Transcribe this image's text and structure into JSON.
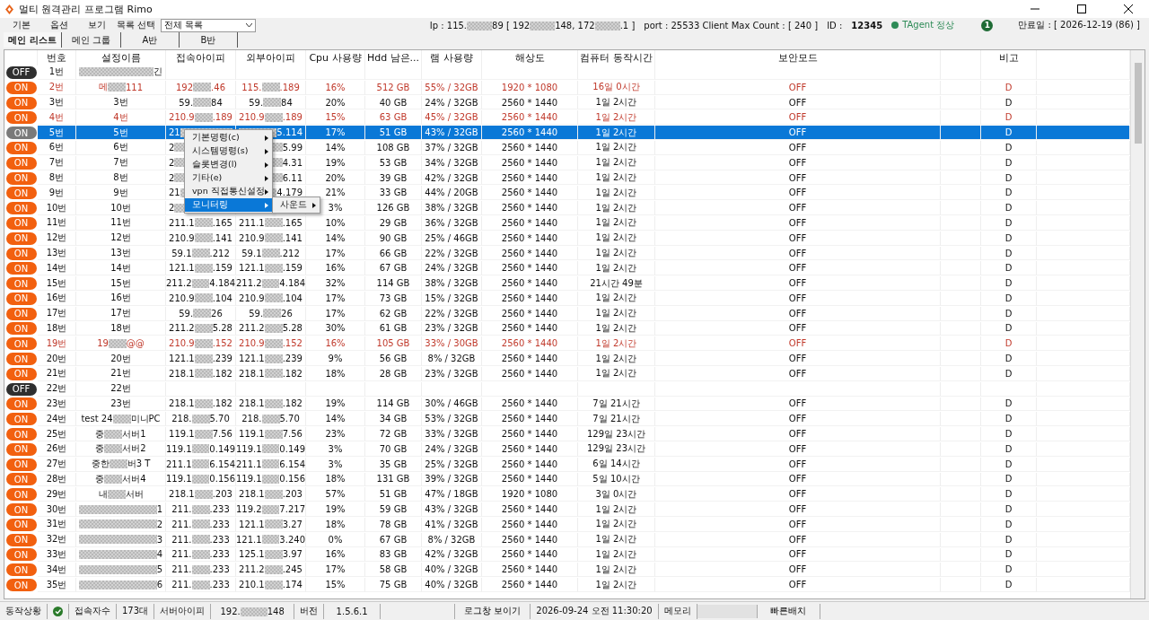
{
  "window": {
    "title": "멀티 원격관리 프로그램 Rimo"
  },
  "menu": [
    "기본",
    "옵션",
    "보기"
  ],
  "list_select": {
    "label": "목록 선택",
    "value": "전체 목록"
  },
  "info": {
    "ip_parts": [
      "Ip : 115.",
      "89 [ 192",
      "148, 172",
      ".1 ]"
    ],
    "port": "port : 25533 Client Max Count :  [ 240 ]",
    "id_label": "ID :",
    "id": "12345",
    "agent": "TAgent 정상",
    "badge": "1",
    "expiry": "만료일 : [ 2026-12-19 (86) ]"
  },
  "tabs": [
    {
      "label": "메인 리스트",
      "selected": true
    },
    {
      "label": "메인 그룹",
      "selected": false
    },
    {
      "label": "A반",
      "selected": false
    },
    {
      "label": "B반",
      "selected": false
    }
  ],
  "table": {
    "columns": [
      "번호",
      "설정이름",
      "접속아이피",
      "외부아이피",
      "Cpu 사용량",
      "Hdd 남은...",
      "램 사용량",
      "해상도",
      "컴퓨터 동작시간",
      "보안모드",
      "",
      "비고"
    ],
    "rows": [
      {
        "power": "OFF",
        "on": false,
        "alert": false,
        "selected": false,
        "num": "1번",
        "name": {
          "tail": "긴"
        }
      },
      {
        "power": "ON",
        "on": true,
        "alert": true,
        "selected": false,
        "num": "2번",
        "name": {
          "head": "메",
          "tail": "111"
        },
        "ip": {
          "head": "192",
          "tail": ".46"
        },
        "ext_ip": {
          "head": "115.",
          "tail": ".189"
        },
        "cpu": "16%",
        "hdd": "512 GB",
        "ram": "55% / 32GB",
        "resolution": "1920 * 1080",
        "uptime": "16일 0시간",
        "security": "OFF",
        "column_12": "D"
      },
      {
        "power": "ON",
        "on": true,
        "alert": false,
        "selected": false,
        "num": "3번",
        "name": "3번",
        "ip": {
          "head": "59.",
          "tail": "84"
        },
        "ext_ip": {
          "head": "59.",
          "tail": "84"
        },
        "cpu": "20%",
        "hdd": "40 GB",
        "ram": "24% / 32GB",
        "resolution": "2560 * 1440",
        "uptime": "1일 2시간",
        "security": "OFF",
        "column_12": "D"
      },
      {
        "power": "ON",
        "on": true,
        "alert": true,
        "selected": false,
        "num": "4번",
        "name": "4번",
        "ip": {
          "head": "210.9",
          "tail": ".189"
        },
        "ext_ip": {
          "head": "210.9",
          "tail": ".189"
        },
        "cpu": "15%",
        "hdd": "63 GB",
        "ram": "45% / 32GB",
        "resolution": "2560 * 1440",
        "uptime": "1일 2시간",
        "security": "OFF",
        "column_12": "D"
      },
      {
        "power": "ON",
        "on": true,
        "alert": false,
        "selected": true,
        "num": "5번",
        "name": "5번",
        "ip": {
          "head": "21"
        },
        "ext_ip": {
          "tail": "5.114"
        },
        "cpu": "17%",
        "hdd": "51 GB",
        "ram": "43% / 32GB",
        "resolution": "2560 * 1440",
        "uptime": "1일 2시간",
        "security": "OFF",
        "column_12": "D"
      },
      {
        "power": "ON",
        "on": true,
        "alert": false,
        "selected": false,
        "num": "6번",
        "name": "6번",
        "ip": {
          "head": "2"
        },
        "ext_ip": {
          "tail": "5.99"
        },
        "cpu": "14%",
        "hdd": "108 GB",
        "ram": "37% / 32GB",
        "resolution": "2560 * 1440",
        "uptime": "1일 2시간",
        "security": "OFF",
        "column_12": "D"
      },
      {
        "power": "ON",
        "on": true,
        "alert": false,
        "selected": false,
        "num": "7번",
        "name": "7번",
        "ip": {
          "head": "2"
        },
        "ext_ip": {
          "tail": "4.31"
        },
        "cpu": "19%",
        "hdd": "53 GB",
        "ram": "34% / 32GB",
        "resolution": "2560 * 1440",
        "uptime": "1일 2시간",
        "security": "OFF",
        "column_12": "D"
      },
      {
        "power": "ON",
        "on": true,
        "alert": false,
        "selected": false,
        "num": "8번",
        "name": "8번",
        "ip": {
          "head": "2"
        },
        "ext_ip": {
          "tail": "6.11"
        },
        "cpu": "20%",
        "hdd": "39 GB",
        "ram": "42% / 32GB",
        "resolution": "2560 * 1440",
        "uptime": "1일 2시간",
        "security": "OFF",
        "column_12": "D"
      },
      {
        "power": "ON",
        "on": true,
        "alert": false,
        "selected": false,
        "num": "9번",
        "name": "9번",
        "ip": {
          "head": "21"
        },
        "ext_ip": {
          "tail": "4.179"
        },
        "cpu": "21%",
        "hdd": "33 GB",
        "ram": "44% / 20GB",
        "resolution": "2560 * 1440",
        "uptime": "1일 2시간",
        "security": "OFF",
        "column_12": "D"
      },
      {
        "power": "ON",
        "on": true,
        "alert": false,
        "selected": false,
        "num": "10번",
        "name": "10번",
        "ip": {
          "head": "2"
        },
        "cpu": "3%",
        "hdd": "126 GB",
        "ram": "38% / 32GB",
        "resolution": "2560 * 1440",
        "uptime": "1일 2시간",
        "security": "OFF",
        "column_12": "D"
      },
      {
        "power": "ON",
        "on": true,
        "alert": false,
        "selected": false,
        "num": "11번",
        "name": "11번",
        "ip": {
          "head": "211.1",
          "tail": ".165"
        },
        "ext_ip": {
          "head": "211.1",
          "tail": ".165"
        },
        "cpu": "10%",
        "hdd": "29 GB",
        "ram": "36% / 32GB",
        "resolution": "2560 * 1440",
        "uptime": "1일 2시간",
        "security": "OFF",
        "column_12": "D"
      },
      {
        "power": "ON",
        "on": true,
        "alert": false,
        "selected": false,
        "num": "12번",
        "name": "12번",
        "ip": {
          "head": "210.9",
          "tail": ".141"
        },
        "ext_ip": {
          "head": "210.9",
          "tail": ".141"
        },
        "cpu": "14%",
        "hdd": "90 GB",
        "ram": "25% / 46GB",
        "resolution": "2560 * 1440",
        "uptime": "1일 2시간",
        "security": "OFF",
        "column_12": "D"
      },
      {
        "power": "ON",
        "on": true,
        "alert": false,
        "selected": false,
        "num": "13번",
        "name": "13번",
        "ip": {
          "head": "59.1",
          "tail": ".212"
        },
        "ext_ip": {
          "head": "59.1",
          "tail": ".212"
        },
        "cpu": "17%",
        "hdd": "66 GB",
        "ram": "22% / 32GB",
        "resolution": "2560 * 1440",
        "uptime": "1일 2시간",
        "security": "OFF",
        "column_12": "D"
      },
      {
        "power": "ON",
        "on": true,
        "alert": false,
        "selected": false,
        "num": "14번",
        "name": "14번",
        "ip": {
          "head": "121.1",
          "tail": ".159"
        },
        "ext_ip": {
          "head": "121.1",
          "tail": ".159"
        },
        "cpu": "16%",
        "hdd": "67 GB",
        "ram": "24% / 32GB",
        "resolution": "2560 * 1440",
        "uptime": "1일 2시간",
        "security": "OFF",
        "column_12": "D"
      },
      {
        "power": "ON",
        "on": true,
        "alert": false,
        "selected": false,
        "num": "15번",
        "name": "15번",
        "ip": {
          "head": "211.2",
          "tail": "4.184"
        },
        "ext_ip": {
          "head": "211.2",
          "tail": "4.184"
        },
        "cpu": "32%",
        "hdd": "114 GB",
        "ram": "38% / 32GB",
        "resolution": "2560 * 1440",
        "uptime": "21시간 49분",
        "security": "OFF",
        "column_12": "D"
      },
      {
        "power": "ON",
        "on": true,
        "alert": false,
        "selected": false,
        "num": "16번",
        "name": "16번",
        "ip": {
          "head": "210.9",
          "tail": ".104"
        },
        "ext_ip": {
          "head": "210.9",
          "tail": ".104"
        },
        "cpu": "17%",
        "hdd": "73 GB",
        "ram": "15% / 32GB",
        "resolution": "2560 * 1440",
        "uptime": "1일 2시간",
        "security": "OFF",
        "column_12": "D"
      },
      {
        "power": "ON",
        "on": true,
        "alert": false,
        "selected": false,
        "num": "17번",
        "name": "17번",
        "ip": {
          "head": "59.",
          "tail": "26"
        },
        "ext_ip": {
          "head": "59.",
          "tail": "26"
        },
        "cpu": "17%",
        "hdd": "62 GB",
        "ram": "22% / 32GB",
        "resolution": "2560 * 1440",
        "uptime": "1일 2시간",
        "security": "OFF",
        "column_12": "D"
      },
      {
        "power": "ON",
        "on": true,
        "alert": false,
        "selected": false,
        "num": "18번",
        "name": "18번",
        "ip": {
          "head": "211.2",
          "tail": "5.28"
        },
        "ext_ip": {
          "head": "211.2",
          "tail": "5.28"
        },
        "cpu": "30%",
        "hdd": "61 GB",
        "ram": "23% / 32GB",
        "resolution": "2560 * 1440",
        "uptime": "1일 2시간",
        "security": "OFF",
        "column_12": "D"
      },
      {
        "power": "ON",
        "on": true,
        "alert": true,
        "selected": false,
        "num": "19번",
        "name": {
          "head": "19",
          "tail": "@@"
        },
        "ip": {
          "head": "210.9",
          "tail": ".152"
        },
        "ext_ip": {
          "head": "210.9",
          "tail": ".152"
        },
        "cpu": "16%",
        "hdd": "105 GB",
        "ram": "33% / 30GB",
        "resolution": "2560 * 1440",
        "uptime": "1일 2시간",
        "security": "OFF",
        "column_12": "D"
      },
      {
        "power": "ON",
        "on": true,
        "alert": false,
        "selected": false,
        "num": "20번",
        "name": "20번",
        "ip": {
          "head": "121.1",
          "tail": ".239"
        },
        "ext_ip": {
          "head": "121.1",
          "tail": ".239"
        },
        "cpu": "9%",
        "hdd": "56 GB",
        "ram": "8% / 32GB",
        "resolution": "2560 * 1440",
        "uptime": "1일 2시간",
        "security": "OFF",
        "column_12": "D"
      },
      {
        "power": "ON",
        "on": true,
        "alert": false,
        "selected": false,
        "num": "21번",
        "name": "21번",
        "ip": {
          "head": "218.1",
          "tail": ".182"
        },
        "ext_ip": {
          "head": "218.1",
          "tail": ".182"
        },
        "cpu": "18%",
        "hdd": "28 GB",
        "ram": "23% / 32GB",
        "resolution": "2560 * 1440",
        "uptime": "1일 2시간",
        "security": "OFF",
        "column_12": "D"
      },
      {
        "power": "OFF",
        "on": false,
        "alert": false,
        "selected": false,
        "num": "22번",
        "name": "22번"
      },
      {
        "power": "ON",
        "on": true,
        "alert": false,
        "selected": false,
        "num": "23번",
        "name": "23번",
        "ip": {
          "head": "218.1",
          "tail": ".182"
        },
        "ext_ip": {
          "head": "218.1",
          "tail": ".182"
        },
        "cpu": "19%",
        "hdd": "114 GB",
        "ram": "30% / 46GB",
        "resolution": "2560 * 1440",
        "uptime": "7일 21시간",
        "security": "OFF",
        "column_12": "D"
      },
      {
        "power": "ON",
        "on": true,
        "alert": false,
        "selected": false,
        "num": "24번",
        "name": {
          "head": "test 24",
          "tail": " 미니PC"
        },
        "ip": {
          "head": "218.",
          "tail": "5.70"
        },
        "ext_ip": {
          "head": "218.",
          "tail": "5.70"
        },
        "cpu": "14%",
        "hdd": "34 GB",
        "ram": "53% / 32GB",
        "resolution": "2560 * 1440",
        "uptime": "7일 21시간",
        "security": "OFF",
        "column_12": "D"
      },
      {
        "power": "ON",
        "on": true,
        "alert": false,
        "selected": false,
        "num": "25번",
        "name": {
          "head": "중",
          "tail": "서버1"
        },
        "ip": {
          "head": "119.1",
          "tail": "7.56"
        },
        "ext_ip": {
          "head": "119.1",
          "tail": "7.56"
        },
        "cpu": "23%",
        "hdd": "72 GB",
        "ram": "33% / 32GB",
        "resolution": "2560 * 1440",
        "uptime": "129일 23시간",
        "security": "OFF",
        "column_12": "D"
      },
      {
        "power": "ON",
        "on": true,
        "alert": false,
        "selected": false,
        "num": "26번",
        "name": {
          "head": "중",
          "tail": "서버2"
        },
        "ip": {
          "head": "119.1",
          "tail": "0.149"
        },
        "ext_ip": {
          "head": "119.1",
          "tail": "0.149"
        },
        "cpu": "3%",
        "hdd": "70 GB",
        "ram": "24% / 32GB",
        "resolution": "2560 * 1440",
        "uptime": "129일 23시간",
        "security": "OFF",
        "column_12": "D"
      },
      {
        "power": "ON",
        "on": true,
        "alert": false,
        "selected": false,
        "num": "27번",
        "name": {
          "head": "중한",
          "tail": "버3 T"
        },
        "ip": {
          "head": "211.1",
          "tail": "6.154"
        },
        "ext_ip": {
          "head": "211.1",
          "tail": "6.154"
        },
        "cpu": "3%",
        "hdd": "35 GB",
        "ram": "25% / 32GB",
        "resolution": "2560 * 1440",
        "uptime": "6일 14시간",
        "security": "OFF",
        "column_12": "D"
      },
      {
        "power": "ON",
        "on": true,
        "alert": false,
        "selected": false,
        "num": "28번",
        "name": {
          "head": "중",
          "tail": "서버4"
        },
        "ip": {
          "head": "119.1",
          "tail": "0.156"
        },
        "ext_ip": {
          "head": "119.1",
          "tail": "0.156"
        },
        "cpu": "18%",
        "hdd": "131 GB",
        "ram": "39% / 32GB",
        "resolution": "2560 * 1440",
        "uptime": "5일 10시간",
        "security": "OFF",
        "column_12": "D"
      },
      {
        "power": "ON",
        "on": true,
        "alert": false,
        "selected": false,
        "num": "29번",
        "name": {
          "head": "내",
          "tail": "서버"
        },
        "ip": {
          "head": "218.1",
          "tail": ".203"
        },
        "ext_ip": {
          "head": "218.1",
          "tail": ".203"
        },
        "cpu": "57%",
        "hdd": "51 GB",
        "ram": "47% / 18GB",
        "resolution": "1920 * 1080",
        "uptime": "3일 0시간",
        "security": "OFF",
        "column_12": "D"
      },
      {
        "power": "ON",
        "on": true,
        "alert": false,
        "selected": false,
        "num": "30번",
        "name": {
          "tail": "1"
        },
        "ip": {
          "head": "211.",
          "tail": ".233"
        },
        "ext_ip": {
          "head": "119.2",
          "tail": "7.217"
        },
        "cpu": "19%",
        "hdd": "59 GB",
        "ram": "43% / 32GB",
        "resolution": "2560 * 1440",
        "uptime": "1일 2시간",
        "security": "OFF",
        "column_12": "D"
      },
      {
        "power": "ON",
        "on": true,
        "alert": false,
        "selected": false,
        "num": "31번",
        "name": {
          "tail": "2"
        },
        "ip": {
          "head": "211.",
          "tail": ".233"
        },
        "ext_ip": {
          "head": "121.1",
          "tail": "3.27"
        },
        "cpu": "18%",
        "hdd": "78 GB",
        "ram": "41% / 32GB",
        "resolution": "2560 * 1440",
        "uptime": "1일 2시간",
        "security": "OFF",
        "column_12": "D"
      },
      {
        "power": "ON",
        "on": true,
        "alert": false,
        "selected": false,
        "num": "32번",
        "name": {
          "tail": "3"
        },
        "ip": {
          "head": "211.",
          "tail": ".233"
        },
        "ext_ip": {
          "head": "121.1",
          "tail": "3.240"
        },
        "cpu": "0%",
        "hdd": "67 GB",
        "ram": "8% / 32GB",
        "resolution": "2560 * 1440",
        "uptime": "1일 2시간",
        "security": "OFF",
        "column_12": "D"
      },
      {
        "power": "ON",
        "on": true,
        "alert": false,
        "selected": false,
        "num": "33번",
        "name": {
          "tail": "4"
        },
        "ip": {
          "head": "211.",
          "tail": ".233"
        },
        "ext_ip": {
          "head": "125.1",
          "tail": "3.97"
        },
        "cpu": "16%",
        "hdd": "83 GB",
        "ram": "42% / 32GB",
        "resolution": "2560 * 1440",
        "uptime": "1일 2시간",
        "security": "OFF",
        "column_12": "D"
      },
      {
        "power": "ON",
        "on": true,
        "alert": false,
        "selected": false,
        "num": "34번",
        "name": {
          "tail": "5"
        },
        "ip": {
          "head": "211.",
          "tail": ".233"
        },
        "ext_ip": {
          "head": "211.2",
          "tail": ".245"
        },
        "cpu": "17%",
        "hdd": "58 GB",
        "ram": "40% / 32GB",
        "resolution": "2560 * 1440",
        "uptime": "1일 2시간",
        "security": "OFF",
        "column_12": "D"
      },
      {
        "power": "ON",
        "on": true,
        "alert": false,
        "selected": false,
        "num": "35번",
        "name": {
          "tail": "6"
        },
        "ip": {
          "head": "211.",
          "tail": ".233"
        },
        "ext_ip": {
          "head": "210.1",
          "tail": ".174"
        },
        "cpu": "15%",
        "hdd": "75 GB",
        "ram": "40% / 32GB",
        "resolution": "2560 * 1440",
        "uptime": "1일 2시간",
        "security": "OFF",
        "column_12": "D"
      }
    ]
  },
  "context_menu": {
    "items": [
      {
        "label": "기본명령(c)",
        "selected": false
      },
      {
        "label": "시스템명령(s)",
        "selected": false
      },
      {
        "label": "슬롯변경(l)",
        "selected": false
      },
      {
        "label": "기타(e)",
        "selected": false
      },
      {
        "label": "vpn 직접통신설정",
        "selected": false
      },
      {
        "label": "모니터링",
        "selected": true
      }
    ],
    "submenu": [
      {
        "label": "사운드",
        "selected": false
      }
    ]
  },
  "status_bar": {
    "state_label": "동작상황",
    "users_label": "접속자수",
    "users": "173대",
    "server_ip_label": "서버아이피",
    "server_ip_parts": [
      "192.",
      "148"
    ],
    "version_label": "버전",
    "version": "1.5.6.1",
    "log_button": "로그창 보이기",
    "datetime": "2026-09-24 오전 11:30:20",
    "memory_label": "메모리",
    "quick_button": "빠른배치"
  }
}
